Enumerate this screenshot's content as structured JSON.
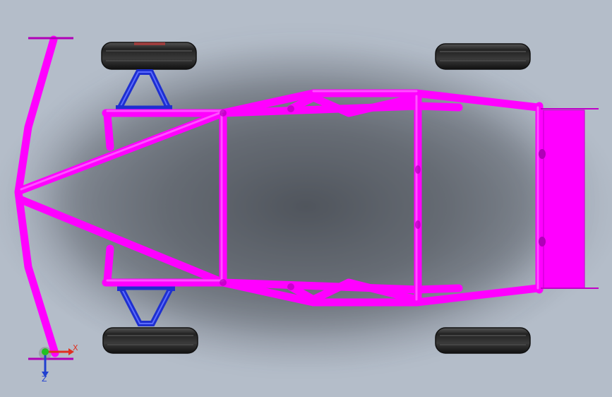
{
  "triad": {
    "x_label": "X",
    "z_label": "Z",
    "x_color": "#e03020",
    "y_color": "#20c020",
    "z_color": "#2040d0"
  },
  "colors": {
    "frame": "#ff00ff",
    "frame_shade": "#b000b8",
    "suspension": "#1e2fd0",
    "tire": "#2a2a2a",
    "background": "#7d838c"
  },
  "icons": [
    "coordinate-triad-icon"
  ]
}
